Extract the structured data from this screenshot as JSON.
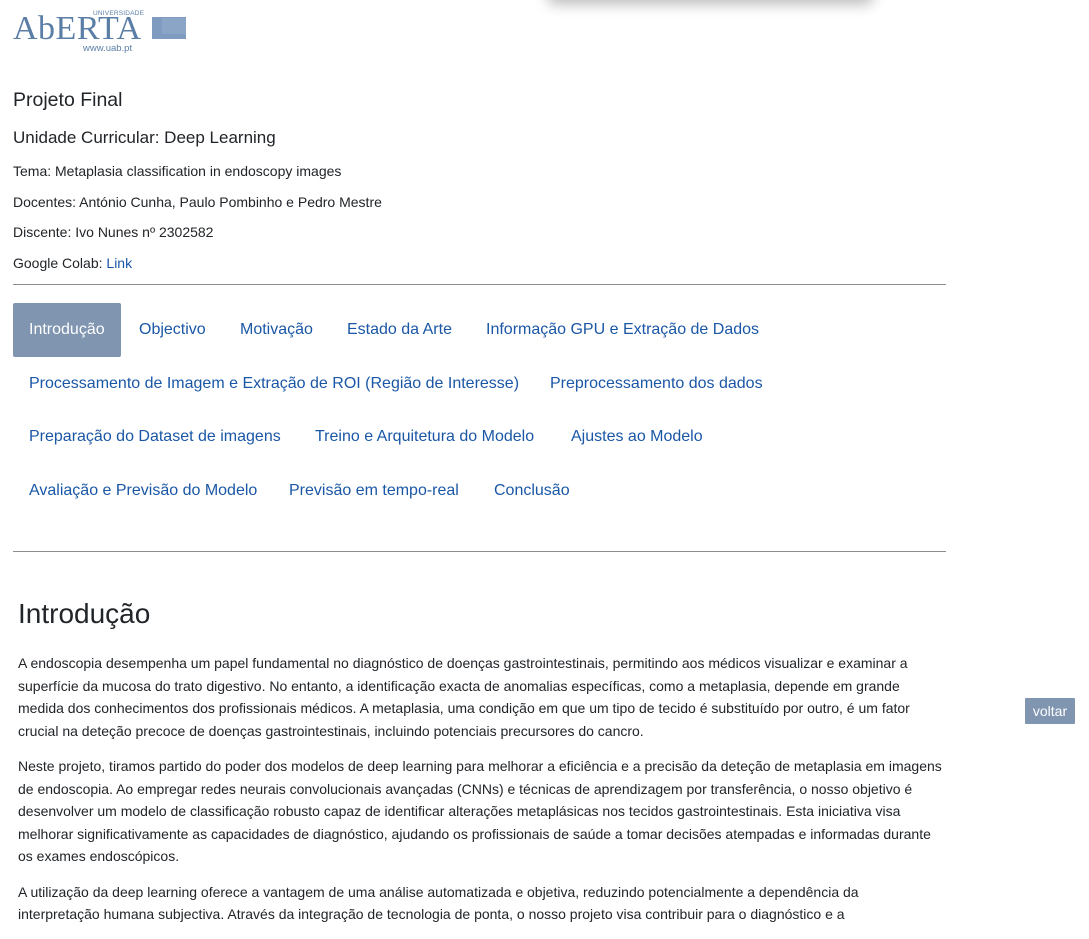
{
  "logo": {
    "university_label": "UNIVERSIDADE",
    "brand": "AbERTA",
    "url": "www.uab.pt"
  },
  "header": {
    "title": "Projeto Final",
    "course": "Unidade Curricular: Deep Learning",
    "tema": "Tema: Metaplasia classification in endoscopy images",
    "docentes": "Docentes: António Cunha, Paulo Pombinho e Pedro Mestre",
    "discente": "Discente: Ivo Nunes nº 2302582",
    "colab_label": "Google Colab:",
    "colab_link": "Link"
  },
  "nav": {
    "tabs": [
      {
        "label": "Introdução",
        "active": true
      },
      {
        "label": "Objectivo"
      },
      {
        "label": "Motivação"
      },
      {
        "label": "Estado da Arte"
      },
      {
        "label": "Informação GPU e Extração de Dados"
      },
      {
        "label": "Processamento de Imagem e Extração de ROI (Região de Interesse)"
      },
      {
        "label": "Preprocessamento dos dados"
      },
      {
        "label": "Preparação do Dataset de imagens"
      },
      {
        "label": "Treino e Arquitetura do Modelo"
      },
      {
        "label": "Ajustes ao Modelo"
      },
      {
        "label": "Avaliação e Previsão do Modelo"
      },
      {
        "label": "Previsão em tempo-real"
      },
      {
        "label": "Conclusão"
      }
    ]
  },
  "content": {
    "heading": "Introdução",
    "paragraphs": [
      "A endoscopia desempenha um papel fundamental no diagnóstico de doenças gastrointestinais, permitindo aos médicos visualizar e examinar a superfície da mucosa do trato digestivo. No entanto, a identificação exacta de anomalias específicas, como a metaplasia, depende em grande medida dos conhecimentos dos profissionais médicos. A metaplasia, uma condição em que um tipo de tecido é substituído por outro, é um fator crucial na deteção precoce de doenças gastrointestinais, incluindo potenciais precursores do cancro.",
      "Neste projeto, tiramos partido do poder dos modelos de deep learning para melhorar a eficiência e a precisão da deteção de metaplasia em imagens de endoscopia. Ao empregar redes neurais convolucionais avançadas (CNNs) e técnicas de aprendizagem por transferência, o nosso objetivo é desenvolver um modelo de classificação robusto capaz de identificar alterações metaplásicas nos tecidos gastrointestinais. Esta iniciativa visa melhorar significativamente as capacidades de diagnóstico, ajudando os profissionais de saúde a tomar decisões atempadas e informadas durante os exames endoscópicos.",
      "A utilização da deep learning oferece a vantagem de uma análise automatizada e objetiva, reduzindo potencialmente a dependência da interpretação humana subjectiva. Através da integração de tecnologia de ponta, o nosso projeto visa contribuir para o diagnóstico e a"
    ]
  },
  "voltar_label": "voltar"
}
